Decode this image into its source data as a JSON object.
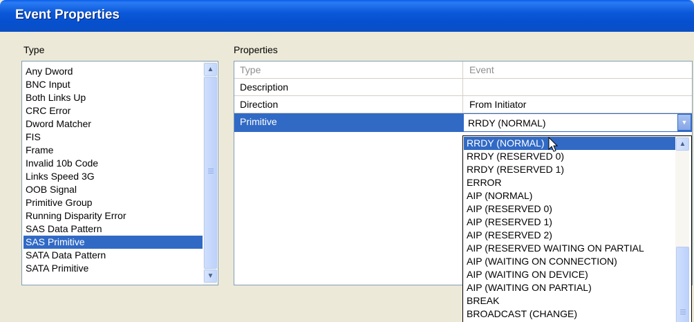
{
  "window": {
    "title": "Event Properties"
  },
  "type_panel": {
    "label": "Type",
    "items": [
      "Any Dword",
      "BNC Input",
      "Both Links Up",
      "CRC Error",
      "Dword Matcher",
      "FIS",
      "Frame",
      "Invalid 10b Code",
      "Links Speed 3G",
      "OOB Signal",
      "Primitive Group",
      "Running Disparity Error",
      "SAS Data Pattern",
      "SAS Primitive",
      "SATA Data Pattern",
      "SATA Primitive"
    ],
    "selected": "SAS Primitive"
  },
  "properties_panel": {
    "label": "Properties",
    "rows": [
      {
        "name": "Type",
        "value": "Event"
      },
      {
        "name": "Description",
        "value": ""
      },
      {
        "name": "Direction",
        "value": "From Initiator"
      },
      {
        "name": "Primitive",
        "value": "RRDY (NORMAL)"
      }
    ],
    "selected_row": "Primitive"
  },
  "primitive_dropdown": {
    "options": [
      "RRDY (NORMAL)",
      "RRDY (RESERVED 0)",
      "RRDY (RESERVED 1)",
      "ERROR",
      "AIP (NORMAL)",
      "AIP (RESERVED 0)",
      "AIP (RESERVED 1)",
      "AIP (RESERVED 2)",
      "AIP (RESERVED WAITING ON PARTIAL",
      "AIP (WAITING ON CONNECTION)",
      "AIP (WAITING ON DEVICE)",
      "AIP (WAITING ON PARTIAL)",
      "BREAK",
      "BROADCAST (CHANGE)"
    ],
    "selected": "RRDY (NORMAL)"
  },
  "icons": {
    "scroll_up": "▲",
    "scroll_down": "▼",
    "dropdown_arrow": "▼"
  },
  "colors": {
    "selection": "#316ac5",
    "titlebar": "#0a5ee8"
  }
}
